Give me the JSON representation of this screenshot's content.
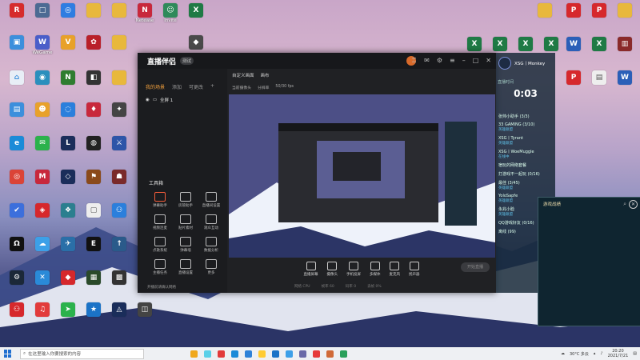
{
  "desktop_icons": [
    {
      "name": "r-icon",
      "label": "",
      "color": "#d62c2c",
      "glyph": "R"
    },
    {
      "name": "app-icon",
      "label": "",
      "color": "#2f7de1",
      "glyph": "◎"
    },
    {
      "name": "folder-icon",
      "label": "",
      "color": "#e8b83c",
      "glyph": ""
    },
    {
      "name": "folder-icon",
      "label": "",
      "color": "#e8b83c",
      "glyph": ""
    },
    {
      "name": "app-icon",
      "label": "Netease",
      "color": "#c8283c",
      "glyph": "N"
    },
    {
      "name": "app-icon",
      "label": "Invite",
      "color": "#2e8a5a",
      "glyph": "☺"
    },
    {
      "name": "excel-icon",
      "label": "",
      "color": "#1f7a45",
      "glyph": "X"
    },
    {
      "name": "this-pc-icon",
      "label": "",
      "color": "#3c8fdc",
      "glyph": "▣"
    },
    {
      "name": "app-icon",
      "label": "WeGame",
      "color": "#4a5ec9",
      "glyph": "W"
    },
    {
      "name": "app-icon",
      "label": "",
      "color": "#e8a12a",
      "glyph": "V"
    },
    {
      "name": "app-icon",
      "label": "",
      "color": "#b9202a",
      "glyph": "✿"
    },
    {
      "name": "folder-icon",
      "label": "",
      "color": "#e8b83c",
      "glyph": ""
    },
    {
      "name": "folder-icon",
      "label": "",
      "color": "#e8b83c",
      "glyph": ""
    },
    {
      "name": "app-icon",
      "label": "",
      "color": "#4a4a4a",
      "glyph": "◆"
    }
  ],
  "window": {
    "title": "直播伴侣",
    "version": "测试",
    "tabs": [
      "我的场景",
      "添加",
      "可更改"
    ],
    "scene_label": "全屏 1",
    "stage_tabs": [
      "自定义画面",
      "画布"
    ],
    "stage_info": [
      "当前摄像头",
      "分辨率",
      "50/30 fps"
    ],
    "tools_title": "工具箱",
    "tools": [
      "弹幕助手",
      "房管助手",
      "直播间设置",
      "视频连麦",
      "贴片素材",
      "观众互动",
      "点歌系统",
      "弹幕墙",
      "数据分析",
      "主播任务",
      "直播设置",
      "更多"
    ],
    "footer": "开播前请确认网络",
    "stage_buttons": [
      "直播屏幕",
      "摄像头",
      "手机投屏",
      "多媒体",
      "麦克风",
      "扬声器"
    ],
    "live_button": "开始直播",
    "status": [
      "网络 CPU",
      "帧率 60",
      "码率 0",
      "丢帧 0%"
    ]
  },
  "chat": {
    "name": "XSG丨Monkey",
    "subtitle": "直播时间",
    "timer": "0:03",
    "messages": [
      {
        "user": "张帅小助手 (3/3)",
        "sub": ""
      },
      {
        "user": "33 GAMING (3/10)",
        "sub": "英雄联盟"
      },
      {
        "user": "XSG丨Tyrant",
        "sub": "英雄联盟"
      },
      {
        "user": "XSG丨WoeMuggle",
        "sub": "在线中"
      },
      {
        "user": "宿玩的网络套餐",
        "sub": ""
      },
      {
        "user": "打游戏不一起玩 (0/16)",
        "sub": ""
      },
      {
        "user": "最佳 (3/45)",
        "sub": "英雄联盟"
      },
      {
        "user": "YoloSapfe",
        "sub": "英雄联盟"
      },
      {
        "user": "永兆小脸",
        "sub": "英雄联盟"
      },
      {
        "user": "QQ游戏好友 (0/16)",
        "sub": ""
      },
      {
        "user": "离线 (99)",
        "sub": ""
      }
    ]
  },
  "side_panel": {
    "title": "游戏战绩"
  },
  "taskbar": {
    "search_placeholder": "在这里输入你要搜索的内容",
    "weather": "30°C 多云",
    "time": "20:20",
    "date": "2021/7/21",
    "app_colors": [
      "#f0a81c",
      "#5bd0e8",
      "#e23b3b",
      "#1a8ad8",
      "#2e82d8",
      "#ffcc33",
      "#1b73c7",
      "#3da0e8",
      "#6a6aa8",
      "#e63a3a",
      "#d06a38",
      "#2aa05a"
    ]
  }
}
